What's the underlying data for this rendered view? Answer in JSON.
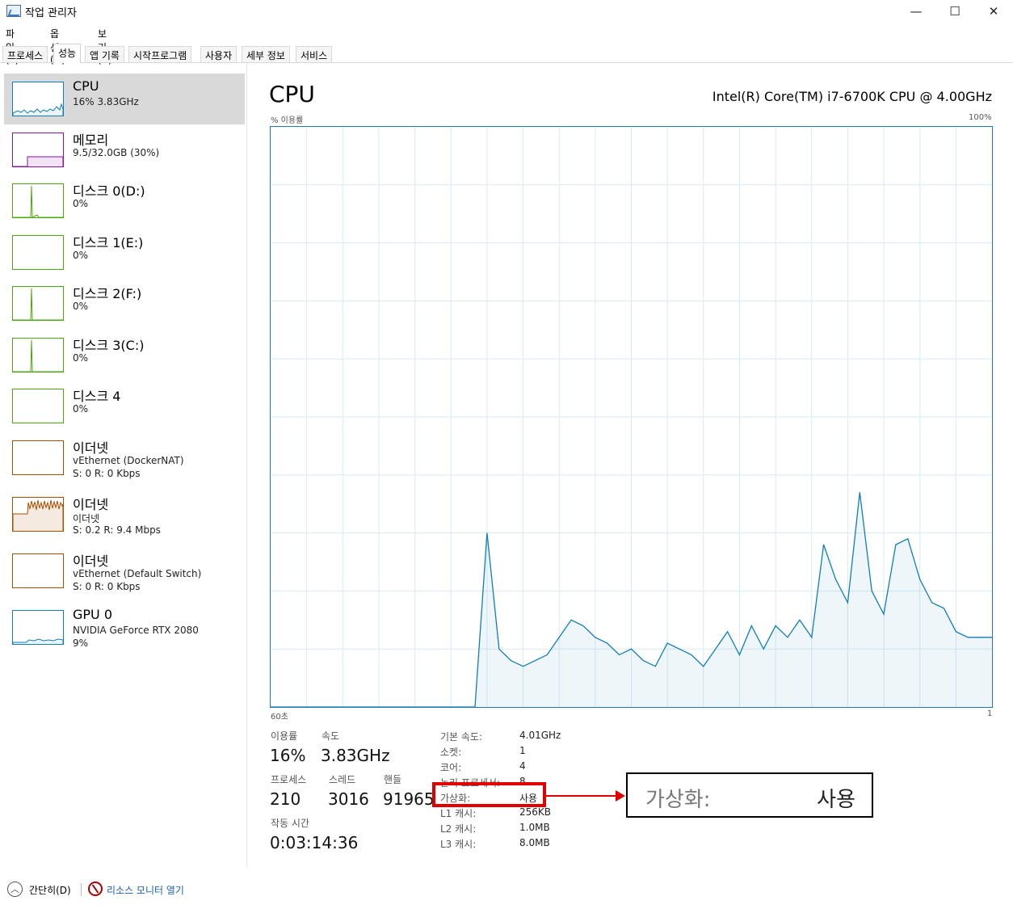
{
  "window": {
    "title": "작업 관리자",
    "minimize": "—",
    "maximize": "☐",
    "close": "✕"
  },
  "menu": [
    "파일(F)",
    "옵션(O)",
    "보기(V)"
  ],
  "tabs": [
    "프로세스",
    "성능",
    "앱 기록",
    "시작프로그램",
    "사용자",
    "세부 정보",
    "서비스"
  ],
  "active_tab": "성능",
  "resources": [
    {
      "name": "CPU",
      "sub": "16% 3.83GHz",
      "sub2": "",
      "color": "#117dbb",
      "selected": true
    },
    {
      "name": "메모리",
      "sub": "9.5/32.0GB (30%)",
      "sub2": "",
      "color": "#8b12ae"
    },
    {
      "name": "디스크 0(D:)",
      "sub": "0%",
      "sub2": "",
      "color": "#4da60c"
    },
    {
      "name": "디스크 1(E:)",
      "sub": "0%",
      "sub2": "",
      "color": "#4da60c"
    },
    {
      "name": "디스크 2(F:)",
      "sub": "0%",
      "sub2": "",
      "color": "#4da60c"
    },
    {
      "name": "디스크 3(C:)",
      "sub": "0%",
      "sub2": "",
      "color": "#4da60c"
    },
    {
      "name": "디스크 4",
      "sub": "0%",
      "sub2": "",
      "color": "#4da60c"
    },
    {
      "name": "이더넷",
      "sub": "vEthernet (DockerNAT)",
      "sub2": "S: 0 R: 0 Kbps",
      "color": "#a74f01"
    },
    {
      "name": "이더넷",
      "sub": "이더넷",
      "sub2": "S: 0.2 R: 9.4 Mbps",
      "color": "#a74f01"
    },
    {
      "name": "이더넷",
      "sub": "vEthernet (Default Switch)",
      "sub2": "S: 0 R: 0 Kbps",
      "color": "#a74f01"
    },
    {
      "name": "GPU 0",
      "sub": "NVIDIA GeForce RTX 2080",
      "sub2": "9%",
      "color": "#117dbb"
    }
  ],
  "main": {
    "title": "CPU",
    "model": "Intel(R) Core(TM) i7-6700K CPU @ 4.00GHz",
    "y_label": "% 이용률",
    "y_max": "100%",
    "x_left": "60초",
    "x_right": "1"
  },
  "stats": {
    "utilization_label": "이용률",
    "utilization": "16%",
    "speed_label": "속도",
    "speed": "3.83GHz",
    "processes_label": "프로세스",
    "processes": "210",
    "threads_label": "스레드",
    "threads": "3016",
    "handles_label": "핸들",
    "handles": "91965",
    "uptime_label": "작동 시간",
    "uptime": "0:03:14:36"
  },
  "details": [
    {
      "label": "기본 속도:",
      "value": "4.01GHz"
    },
    {
      "label": "소켓:",
      "value": "1"
    },
    {
      "label": "코어:",
      "value": "4"
    },
    {
      "label": "논리 프로세서:",
      "value": "8"
    },
    {
      "label": "가상화:",
      "value": "사용"
    },
    {
      "label": "L1 캐시:",
      "value": "256KB"
    },
    {
      "label": "L2 캐시:",
      "value": "1.0MB"
    },
    {
      "label": "L3 캐시:",
      "value": "8.0MB"
    }
  ],
  "callout": {
    "label": "가상화:",
    "value": "사용"
  },
  "bottom": {
    "fewer": "간단히(D)",
    "resmon": "리소스 모니터 열기"
  },
  "chart_data": {
    "type": "area",
    "x_range": [
      60,
      0
    ],
    "ylim": [
      0,
      100
    ],
    "grid": true,
    "color": "#117dbb",
    "values": [
      0,
      0,
      0,
      0,
      0,
      0,
      0,
      0,
      0,
      0,
      0,
      0,
      0,
      0,
      0,
      0,
      0,
      0,
      30,
      10,
      8,
      7,
      8,
      9,
      12,
      15,
      14,
      12,
      11,
      9,
      10,
      8,
      7,
      11,
      10,
      9,
      7,
      10,
      13,
      9,
      14,
      10,
      14,
      12,
      15,
      12,
      28,
      22,
      18,
      37,
      20,
      16,
      28,
      29,
      22,
      18,
      17,
      13,
      12,
      12,
      12
    ]
  }
}
